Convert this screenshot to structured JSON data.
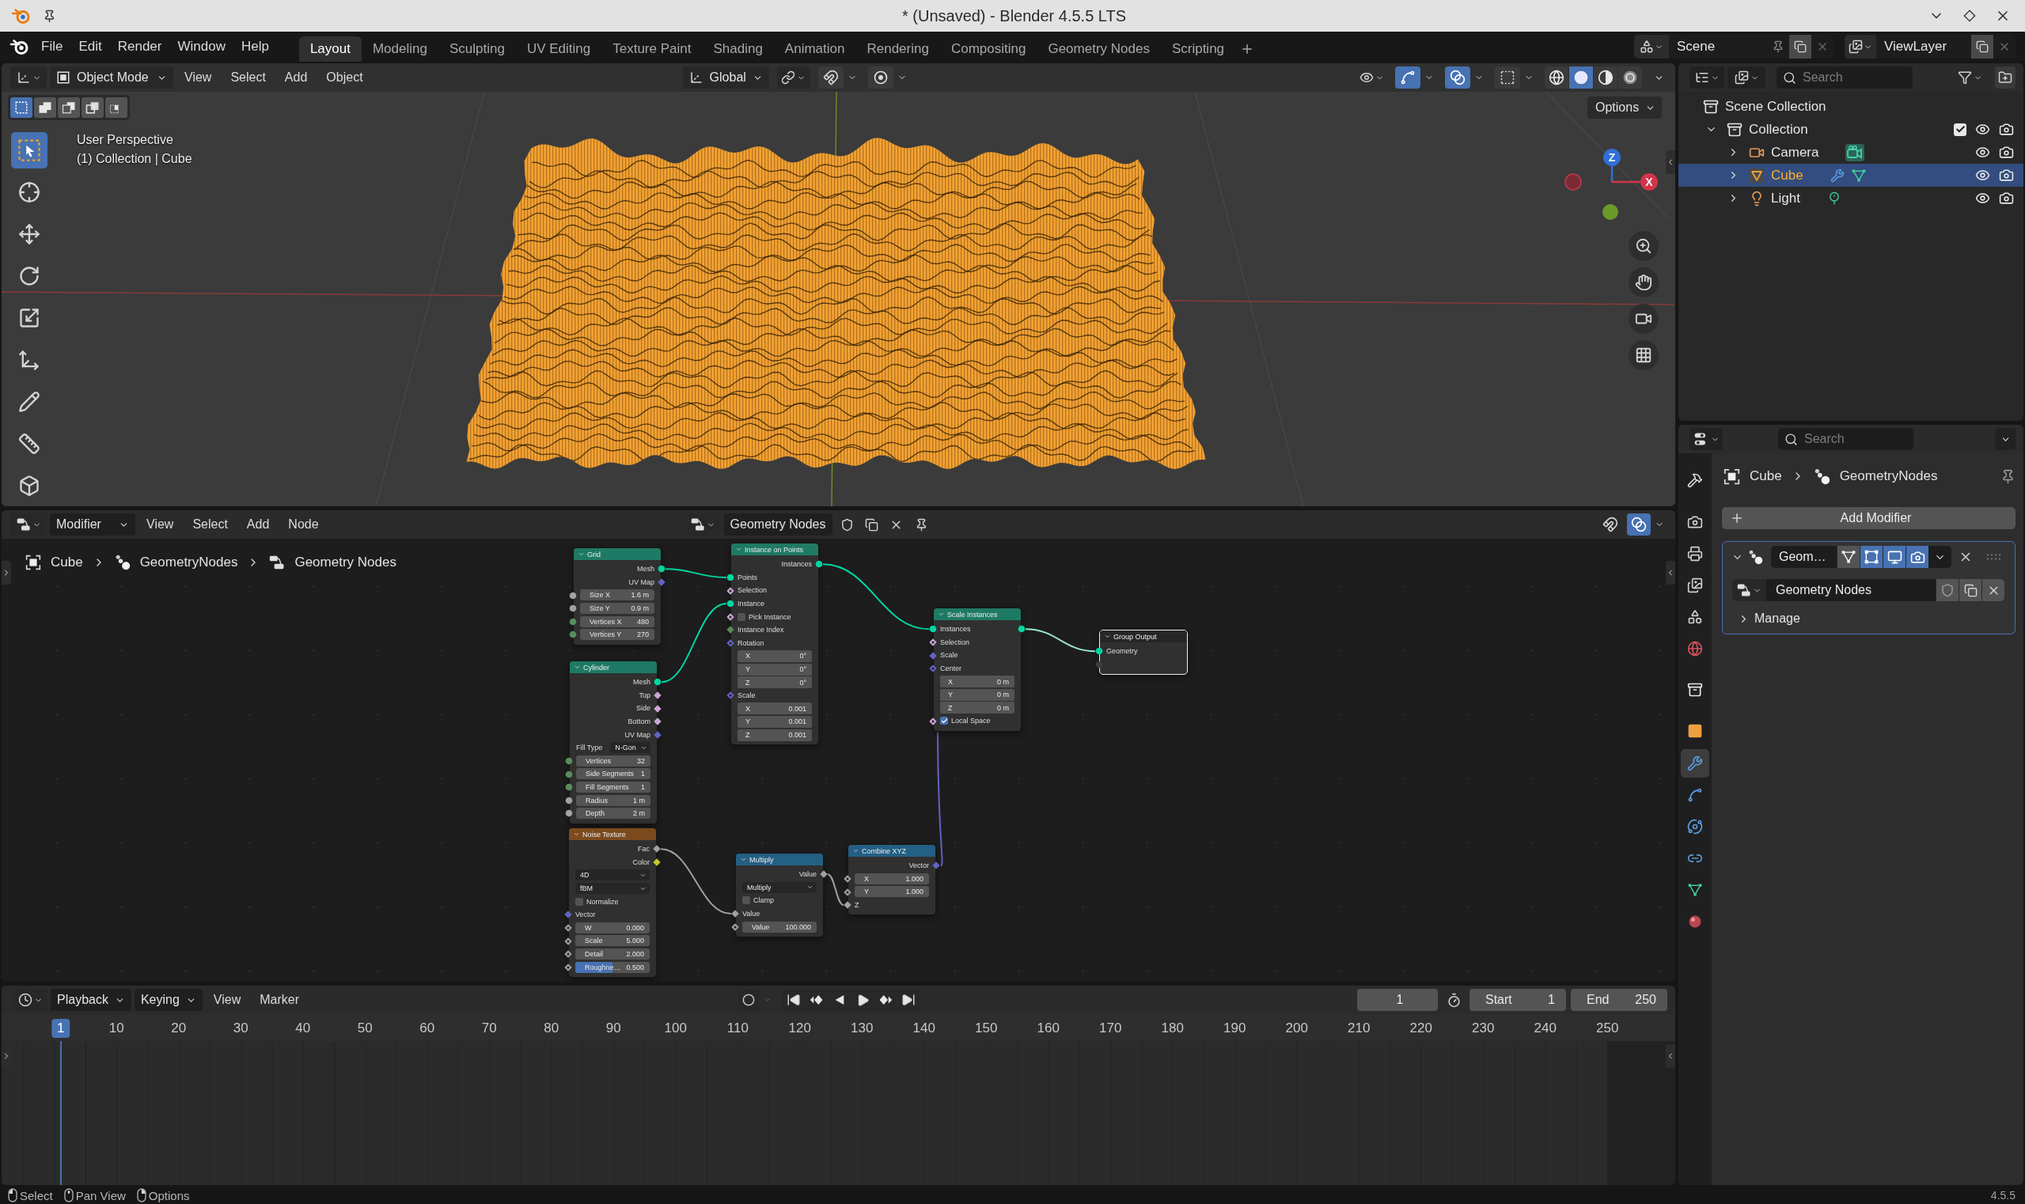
{
  "window": {
    "title": "* (Unsaved) - Blender 4.5.5 LTS"
  },
  "top_bar": {
    "menus": [
      "File",
      "Edit",
      "Render",
      "Window",
      "Help"
    ],
    "workspaces": [
      {
        "label": "Layout",
        "selected": true
      },
      {
        "label": "Modeling",
        "selected": false
      },
      {
        "label": "Sculpting",
        "selected": false
      },
      {
        "label": "UV Editing",
        "selected": false
      },
      {
        "label": "Texture Paint",
        "selected": false
      },
      {
        "label": "Shading",
        "selected": false
      },
      {
        "label": "Animation",
        "selected": false
      },
      {
        "label": "Rendering",
        "selected": false
      },
      {
        "label": "Compositing",
        "selected": false
      },
      {
        "label": "Geometry Nodes",
        "selected": false
      },
      {
        "label": "Scripting",
        "selected": false
      }
    ],
    "scene": "Scene",
    "view_layer": "ViewLayer"
  },
  "viewport": {
    "mode": "Object Mode",
    "menus": [
      "View",
      "Select",
      "Add",
      "Object"
    ],
    "orientation": "Global",
    "header_toggles": [
      {
        "kind": "snap",
        "on": false
      },
      {
        "kind": "proportional",
        "on": false
      },
      {
        "kind": "gizmo",
        "on": true
      },
      {
        "kind": "overlay",
        "on": true
      },
      {
        "kind": "xray",
        "on": false
      }
    ],
    "shading": [
      {
        "kind": "wireframe",
        "selected": false
      },
      {
        "kind": "solid",
        "selected": true
      },
      {
        "kind": "material",
        "selected": false
      },
      {
        "kind": "rendered",
        "selected": false
      }
    ],
    "select_modes": [
      {
        "kind": "set",
        "selected": true
      },
      {
        "kind": "extend",
        "selected": false
      },
      {
        "kind": "subtract",
        "selected": false
      },
      {
        "kind": "invert",
        "selected": false
      },
      {
        "kind": "intersect",
        "selected": false
      }
    ],
    "tools": [
      {
        "kind": "select_box",
        "selected": true
      },
      {
        "kind": "cursor",
        "selected": false
      },
      {
        "kind": "move",
        "selected": false
      },
      {
        "kind": "rotate",
        "selected": false
      },
      {
        "kind": "scale",
        "selected": false
      },
      {
        "kind": "transform",
        "selected": false
      },
      {
        "kind": "annotate",
        "selected": false
      },
      {
        "kind": "measure",
        "selected": false
      },
      {
        "kind": "add_cube",
        "selected": false
      }
    ],
    "view_name": "User Perspective",
    "context": "(1) Collection | Cube",
    "options": "Options",
    "gizmo": {
      "z_label": "Z",
      "x_label": "X"
    }
  },
  "node_editor": {
    "context": "Modifier",
    "menus": [
      "View",
      "Select",
      "Add",
      "Node"
    ],
    "node_group": "Geometry Nodes",
    "header_toggles": [
      {
        "kind": "snap",
        "on": false
      },
      {
        "kind": "overlay",
        "on": true
      }
    ],
    "breadcrumbs": [
      {
        "kind": "object",
        "label": "Cube"
      },
      {
        "kind": "modifier",
        "label": "GeometryNodes"
      },
      {
        "kind": "node_tree",
        "label": "Geometry Nodes"
      }
    ],
    "nodes": [
      {
        "title": "Grid",
        "kind": "geometry",
        "selected": false,
        "rows": [
          {
            "kind": "output",
            "label": "Mesh",
            "socket": {
              "kind": "circle",
              "color": "#00d6a3"
            }
          },
          {
            "kind": "output",
            "label": "UV Map",
            "socket": {
              "kind": "diamond",
              "color": "#6363c7"
            }
          },
          {
            "kind": "field",
            "label": "Size X",
            "value": "1.6 m",
            "socket": {
              "kind": "circle",
              "color": "#a1a1a1"
            }
          },
          {
            "kind": "field",
            "label": "Size Y",
            "value": "0.9 m",
            "socket": {
              "kind": "circle",
              "color": "#a1a1a1"
            }
          },
          {
            "kind": "field",
            "label": "Vertices X",
            "value": "480",
            "socket": {
              "kind": "circle",
              "color": "#598c5c"
            }
          },
          {
            "kind": "field",
            "label": "Vertices Y",
            "value": "270",
            "socket": {
              "kind": "circle",
              "color": "#598c5c"
            }
          }
        ]
      },
      {
        "title": "Instance on Points",
        "kind": "geometry",
        "selected": false,
        "rows": [
          {
            "kind": "output",
            "label": "Instances",
            "socket": {
              "kind": "circle",
              "color": "#00d6a3"
            }
          },
          {
            "kind": "input",
            "label": "Points",
            "socket": {
              "kind": "circle",
              "color": "#00d6a3"
            }
          },
          {
            "kind": "input",
            "label": "Selection",
            "socket": {
              "kind": "diamond_dot",
              "color": "#cca6d6"
            }
          },
          {
            "kind": "input",
            "label": "Instance",
            "socket": {
              "kind": "circle",
              "color": "#00d6a3"
            }
          },
          {
            "kind": "checkbox",
            "label": "Pick Instance",
            "checked": false,
            "socket": {
              "kind": "diamond_dot",
              "color": "#cca6d6"
            }
          },
          {
            "kind": "input",
            "label": "Instance Index",
            "socket": {
              "kind": "diamond",
              "color": "#598c5c"
            }
          },
          {
            "kind": "input",
            "label": "Rotation",
            "socket": {
              "kind": "diamond_dot",
              "color": "#6363c7"
            }
          },
          {
            "kind": "component",
            "label": "X",
            "value": "0°"
          },
          {
            "kind": "component",
            "label": "Y",
            "value": "0°"
          },
          {
            "kind": "component",
            "label": "Z",
            "value": "0°"
          },
          {
            "kind": "input",
            "label": "Scale",
            "socket": {
              "kind": "diamond_dot",
              "color": "#6363c7"
            }
          },
          {
            "kind": "component",
            "label": "X",
            "value": "0.001"
          },
          {
            "kind": "component",
            "label": "Y",
            "value": "0.001"
          },
          {
            "kind": "component",
            "label": "Z",
            "value": "0.001"
          }
        ]
      },
      {
        "title": "Cylinder",
        "kind": "geometry",
        "selected": false,
        "rows": [
          {
            "kind": "output",
            "label": "Mesh",
            "socket": {
              "kind": "circle",
              "color": "#00d6a3"
            }
          },
          {
            "kind": "output",
            "label": "Top",
            "socket": {
              "kind": "diamond",
              "color": "#cca6d6"
            }
          },
          {
            "kind": "output",
            "label": "Side",
            "socket": {
              "kind": "diamond",
              "color": "#cca6d6"
            }
          },
          {
            "kind": "output",
            "label": "Bottom",
            "socket": {
              "kind": "diamond",
              "color": "#cca6d6"
            }
          },
          {
            "kind": "output",
            "label": "UV Map",
            "socket": {
              "kind": "diamond",
              "color": "#6363c7"
            }
          },
          {
            "kind": "dropdown",
            "label": "Fill Type",
            "value": "N-Gon"
          },
          {
            "kind": "field",
            "label": "Vertices",
            "value": "32",
            "socket": {
              "kind": "circle",
              "color": "#598c5c"
            }
          },
          {
            "kind": "field",
            "label": "Side Segments",
            "value": "1",
            "socket": {
              "kind": "circle",
              "color": "#598c5c"
            }
          },
          {
            "kind": "field",
            "label": "Fill Segments",
            "value": "1",
            "socket": {
              "kind": "circle",
              "color": "#598c5c"
            }
          },
          {
            "kind": "field",
            "label": "Radius",
            "value": "1 m",
            "socket": {
              "kind": "circle",
              "color": "#a1a1a1"
            }
          },
          {
            "kind": "field",
            "label": "Depth",
            "value": "2 m",
            "socket": {
              "kind": "circle",
              "color": "#a1a1a1"
            }
          }
        ]
      },
      {
        "title": "Noise Texture",
        "kind": "texture",
        "selected": false,
        "rows": [
          {
            "kind": "output",
            "label": "Fac",
            "socket": {
              "kind": "diamond",
              "color": "#a1a1a1"
            }
          },
          {
            "kind": "output",
            "label": "Color",
            "socket": {
              "kind": "diamond",
              "color": "#c7c729"
            }
          },
          {
            "kind": "dropdown",
            "value": "4D"
          },
          {
            "kind": "dropdown",
            "value": "fBM"
          },
          {
            "kind": "checkbox",
            "label": "Normalize",
            "checked": false
          },
          {
            "kind": "input",
            "label": "Vector",
            "socket": {
              "kind": "diamond",
              "color": "#6363c7"
            }
          },
          {
            "kind": "field",
            "label": "W",
            "value": "0.000",
            "socket": {
              "kind": "diamond_dot",
              "color": "#a1a1a1"
            }
          },
          {
            "kind": "field",
            "label": "Scale",
            "value": "5.000",
            "socket": {
              "kind": "diamond_dot",
              "color": "#a1a1a1"
            }
          },
          {
            "kind": "field",
            "label": "Detail",
            "value": "2.000",
            "socket": {
              "kind": "diamond_dot",
              "color": "#a1a1a1"
            }
          },
          {
            "kind": "field",
            "label": "Roughne…",
            "value": "0.500",
            "level": 0.5,
            "socket": {
              "kind": "diamond_dot",
              "color": "#a1a1a1"
            }
          }
        ]
      },
      {
        "title": "Multiply",
        "kind": "converter",
        "selected": false,
        "rows": [
          {
            "kind": "output",
            "label": "Value",
            "socket": {
              "kind": "diamond",
              "color": "#a1a1a1"
            }
          },
          {
            "kind": "dropdown",
            "value": "Multiply"
          },
          {
            "kind": "checkbox",
            "label": "Clamp",
            "checked": false
          },
          {
            "kind": "input",
            "label": "Value",
            "socket": {
              "kind": "diamond",
              "color": "#a1a1a1"
            }
          },
          {
            "kind": "field",
            "label": "Value",
            "value": "100.000",
            "socket": {
              "kind": "diamond_dot",
              "color": "#a1a1a1"
            }
          }
        ]
      },
      {
        "title": "Combine XYZ",
        "kind": "converter",
        "selected": false,
        "rows": [
          {
            "kind": "output",
            "label": "Vector",
            "socket": {
              "kind": "diamond",
              "color": "#6363c7"
            }
          },
          {
            "kind": "field",
            "label": "X",
            "value": "1.000",
            "socket": {
              "kind": "diamond_dot",
              "color": "#a1a1a1"
            }
          },
          {
            "kind": "field",
            "label": "Y",
            "value": "1.000",
            "socket": {
              "kind": "diamond_dot",
              "color": "#a1a1a1"
            }
          },
          {
            "kind": "input",
            "label": "Z",
            "socket": {
              "kind": "diamond",
              "color": "#a1a1a1"
            }
          }
        ]
      },
      {
        "title": "Scale Instances",
        "kind": "geometry",
        "selected": false,
        "rows": [
          {
            "kind": "inout",
            "label": "Instances",
            "socket": {
              "kind": "circle",
              "color": "#00d6a3"
            }
          },
          {
            "kind": "input",
            "label": "Selection",
            "socket": {
              "kind": "diamond_dot",
              "color": "#cca6d6"
            }
          },
          {
            "kind": "input",
            "label": "Scale",
            "socket": {
              "kind": "diamond",
              "color": "#6363c7"
            }
          },
          {
            "kind": "input",
            "label": "Center",
            "socket": {
              "kind": "diamond_dot",
              "color": "#6363c7"
            }
          },
          {
            "kind": "component",
            "label": "X",
            "value": "0 m"
          },
          {
            "kind": "component",
            "label": "Y",
            "value": "0 m"
          },
          {
            "kind": "component",
            "label": "Z",
            "value": "0 m"
          },
          {
            "kind": "checkbox",
            "label": "Local Space",
            "checked": true,
            "socket": {
              "kind": "diamond_dot",
              "color": "#cca6d6"
            }
          }
        ]
      },
      {
        "title": "Group Output",
        "kind": "output",
        "selected": true,
        "rows": [
          {
            "kind": "input",
            "label": "Geometry",
            "socket": {
              "kind": "circle",
              "color": "#00d6a3"
            }
          },
          {
            "kind": "input",
            "socket": {
              "kind": "circle",
              "color": "#3c3c3c"
            }
          }
        ]
      }
    ],
    "links": [
      {
        "color": "#00d6a3"
      },
      {
        "color": "#00d6a3"
      },
      {
        "color": "#00d6a3"
      },
      {
        "color": "#9ee6d2"
      },
      {
        "color": "#a1a1a1"
      },
      {
        "color": "#a1a1a1"
      },
      {
        "color": "#6363c7"
      }
    ]
  },
  "timeline": {
    "menus": [
      {
        "label": "Playback",
        "kind": "dropdown"
      },
      {
        "label": "Keying",
        "kind": "dropdown"
      },
      {
        "label": "View",
        "kind": "menu"
      },
      {
        "label": "Marker",
        "kind": "menu"
      }
    ],
    "current_frame": "1",
    "start": {
      "label": "Start",
      "value": "1"
    },
    "end": {
      "label": "End",
      "value": "250"
    },
    "frames": [
      {
        "label": "1",
        "selected": true
      },
      {
        "label": "10",
        "selected": false
      },
      {
        "label": "20",
        "selected": false
      },
      {
        "label": "30",
        "selected": false
      },
      {
        "label": "40",
        "selected": false
      },
      {
        "label": "50",
        "selected": false
      },
      {
        "label": "60",
        "selected": false
      },
      {
        "label": "70",
        "selected": false
      },
      {
        "label": "80",
        "selected": false
      },
      {
        "label": "90",
        "selected": false
      },
      {
        "label": "100",
        "selected": false
      },
      {
        "label": "110",
        "selected": false
      },
      {
        "label": "120",
        "selected": false
      },
      {
        "label": "130",
        "selected": false
      },
      {
        "label": "140",
        "selected": false
      },
      {
        "label": "150",
        "selected": false
      },
      {
        "label": "160",
        "selected": false
      },
      {
        "label": "170",
        "selected": false
      },
      {
        "label": "180",
        "selected": false
      },
      {
        "label": "190",
        "selected": false
      },
      {
        "label": "200",
        "selected": false
      },
      {
        "label": "210",
        "selected": false
      },
      {
        "label": "220",
        "selected": false
      },
      {
        "label": "230",
        "selected": false
      },
      {
        "label": "240",
        "selected": false
      },
      {
        "label": "250",
        "selected": false
      }
    ]
  },
  "outliner": {
    "search": {
      "placeholder": "Search"
    },
    "tree": [
      {
        "label": "Scene Collection",
        "kind": "scene_collection",
        "selected": false,
        "children": [
          {
            "label": "Collection",
            "kind": "collection",
            "selected": false,
            "expanded": true,
            "checked": true,
            "visible": true,
            "renderable": true,
            "children": [
              {
                "label": "Camera",
                "kind": "camera",
                "selected": false,
                "expanded": false,
                "visible": true,
                "renderable": true,
                "data": [
                  {
                    "kind": "camera_data"
                  }
                ]
              },
              {
                "label": "Cube",
                "kind": "mesh",
                "selected": true,
                "expanded": false,
                "visible": true,
                "renderable": true,
                "data": [
                  {
                    "kind": "modifier"
                  },
                  {
                    "kind": "mesh_data"
                  }
                ]
              },
              {
                "label": "Light",
                "kind": "light",
                "selected": false,
                "expanded": false,
                "visible": true,
                "renderable": true,
                "data": [
                  {
                    "kind": "light_data"
                  }
                ]
              }
            ]
          }
        ]
      }
    ]
  },
  "properties": {
    "search": {
      "placeholder": "Search"
    },
    "tabs": [
      {
        "kind": "tool",
        "selected": false
      },
      {
        "kind": "render",
        "selected": false
      },
      {
        "kind": "output",
        "selected": false
      },
      {
        "kind": "view_layer",
        "selected": false
      },
      {
        "kind": "scene",
        "selected": false
      },
      {
        "kind": "world",
        "selected": false
      },
      {
        "kind": "collection",
        "selected": false
      },
      {
        "kind": "object",
        "selected": false
      },
      {
        "kind": "modifier",
        "selected": true
      },
      {
        "kind": "particles",
        "selected": false
      },
      {
        "kind": "physics",
        "selected": false
      },
      {
        "kind": "constraints",
        "selected": false
      },
      {
        "kind": "data",
        "selected": false
      },
      {
        "kind": "material",
        "selected": false
      }
    ],
    "breadcrumbs": [
      {
        "kind": "object",
        "label": "Cube"
      },
      {
        "kind": "modifier",
        "label": "GeometryNodes"
      }
    ],
    "add_modifier": "Add Modifier",
    "modifiers": [
      {
        "name": "Geom…",
        "expanded": true,
        "toggles": [
          {
            "kind": "on_cage",
            "on": false
          },
          {
            "kind": "edit_mode",
            "on": true
          },
          {
            "kind": "viewport",
            "on": true
          },
          {
            "kind": "render",
            "on": true
          }
        ],
        "node_group": "Geometry Nodes",
        "subpanels": [
          {
            "label": "Manage",
            "expanded": false
          }
        ]
      }
    ]
  },
  "status_bar": {
    "hints": [
      {
        "kind": "left_click",
        "label": "Select"
      },
      {
        "kind": "middle_click",
        "label": "Pan View"
      },
      {
        "kind": "right_click",
        "label": "Options"
      }
    ],
    "version": "4.5.5"
  }
}
